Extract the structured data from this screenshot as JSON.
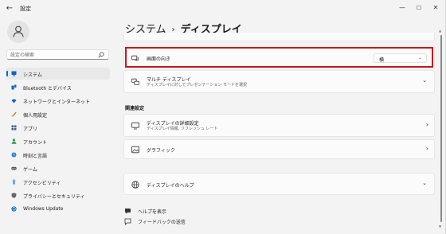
{
  "window": {
    "title": "設定",
    "back_glyph": "←",
    "min_glyph": "—",
    "max_glyph": "☐",
    "close_glyph": "✕"
  },
  "sidebar": {
    "search_placeholder": "設定の検索",
    "items": [
      {
        "label": "システム",
        "icon": "monitor-icon",
        "color": "#0067c0",
        "active": true
      },
      {
        "label": "Bluetooth とデバイス",
        "icon": "bluetooth-icon",
        "color": "#0067c0"
      },
      {
        "label": "ネットワークとインターネット",
        "icon": "wifi-icon",
        "color": "#0067c0"
      },
      {
        "label": "個人用設定",
        "icon": "brush-icon",
        "color": "#b0601a"
      },
      {
        "label": "アプリ",
        "icon": "apps-icon",
        "color": "#3b5b8c"
      },
      {
        "label": "アカウント",
        "icon": "person-icon",
        "color": "#2b9a52"
      },
      {
        "label": "時刻と言語",
        "icon": "globe-clock-icon",
        "color": "#2b7bd6"
      },
      {
        "label": "ゲーム",
        "icon": "gamepad-icon",
        "color": "#555555"
      },
      {
        "label": "アクセシビリティ",
        "icon": "accessibility-icon",
        "color": "#2b7bd6"
      },
      {
        "label": "プライバシーとセキュリティ",
        "icon": "shield-icon",
        "color": "#666666"
      },
      {
        "label": "Windows Update",
        "icon": "update-icon",
        "color": "#0067c0"
      }
    ]
  },
  "main": {
    "breadcrumb_parent": "システム",
    "breadcrumb_sep": "›",
    "breadcrumb_current": "ディスプレイ",
    "orientation": {
      "title": "画面の向き",
      "value": "横",
      "chevron": "⌄"
    },
    "multi_display": {
      "title": "マルチ ディスプレイ",
      "subtitle": "ディスプレイに対してプレゼンテーション モードを選択",
      "chevron": "⌄"
    },
    "related_heading": "関連設定",
    "advanced_display": {
      "title": "ディスプレイの詳細設定",
      "subtitle": "ディスプレイ情報, リフレッシュ レート",
      "chevron": "›"
    },
    "graphics": {
      "title": "グラフィック",
      "chevron": "›"
    },
    "display_help": {
      "title": "ディスプレイのヘルプ",
      "chevron": "⌄"
    },
    "get_help": "ヘルプを表示",
    "send_feedback": "フィードバックの送信"
  },
  "colors": {
    "accent": "#0067c0",
    "highlight_border": "#c8161d"
  }
}
